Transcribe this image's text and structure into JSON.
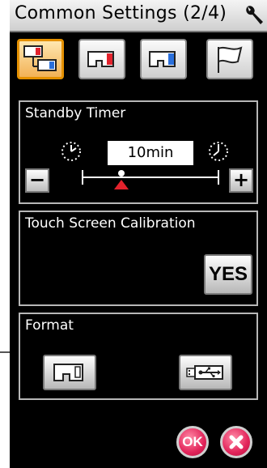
{
  "header": {
    "title": "Common Settings (2/4)",
    "icon": "wrench-icon"
  },
  "tabs": [
    {
      "icon": "machine-pair-icon",
      "active": true
    },
    {
      "icon": "machine-red-icon",
      "active": false
    },
    {
      "icon": "machine-blue-icon",
      "active": false
    },
    {
      "icon": "flag-icon",
      "active": false
    }
  ],
  "standby": {
    "title": "Standby Timer",
    "value": "10min",
    "minus_label": "−",
    "plus_label": "+",
    "level_fraction": 0.28
  },
  "calibration": {
    "title": "Touch Screen Calibration",
    "button_label": "YES"
  },
  "format": {
    "title": "Format",
    "machine_icon": "machine-icon",
    "usb_icon": "usb-icon"
  },
  "footer": {
    "ok_label": "OK",
    "close_icon": "close-icon"
  },
  "colors": {
    "accent": "#e59100",
    "ok_red": "#e2245a",
    "thumb_red": "#e3222c"
  }
}
